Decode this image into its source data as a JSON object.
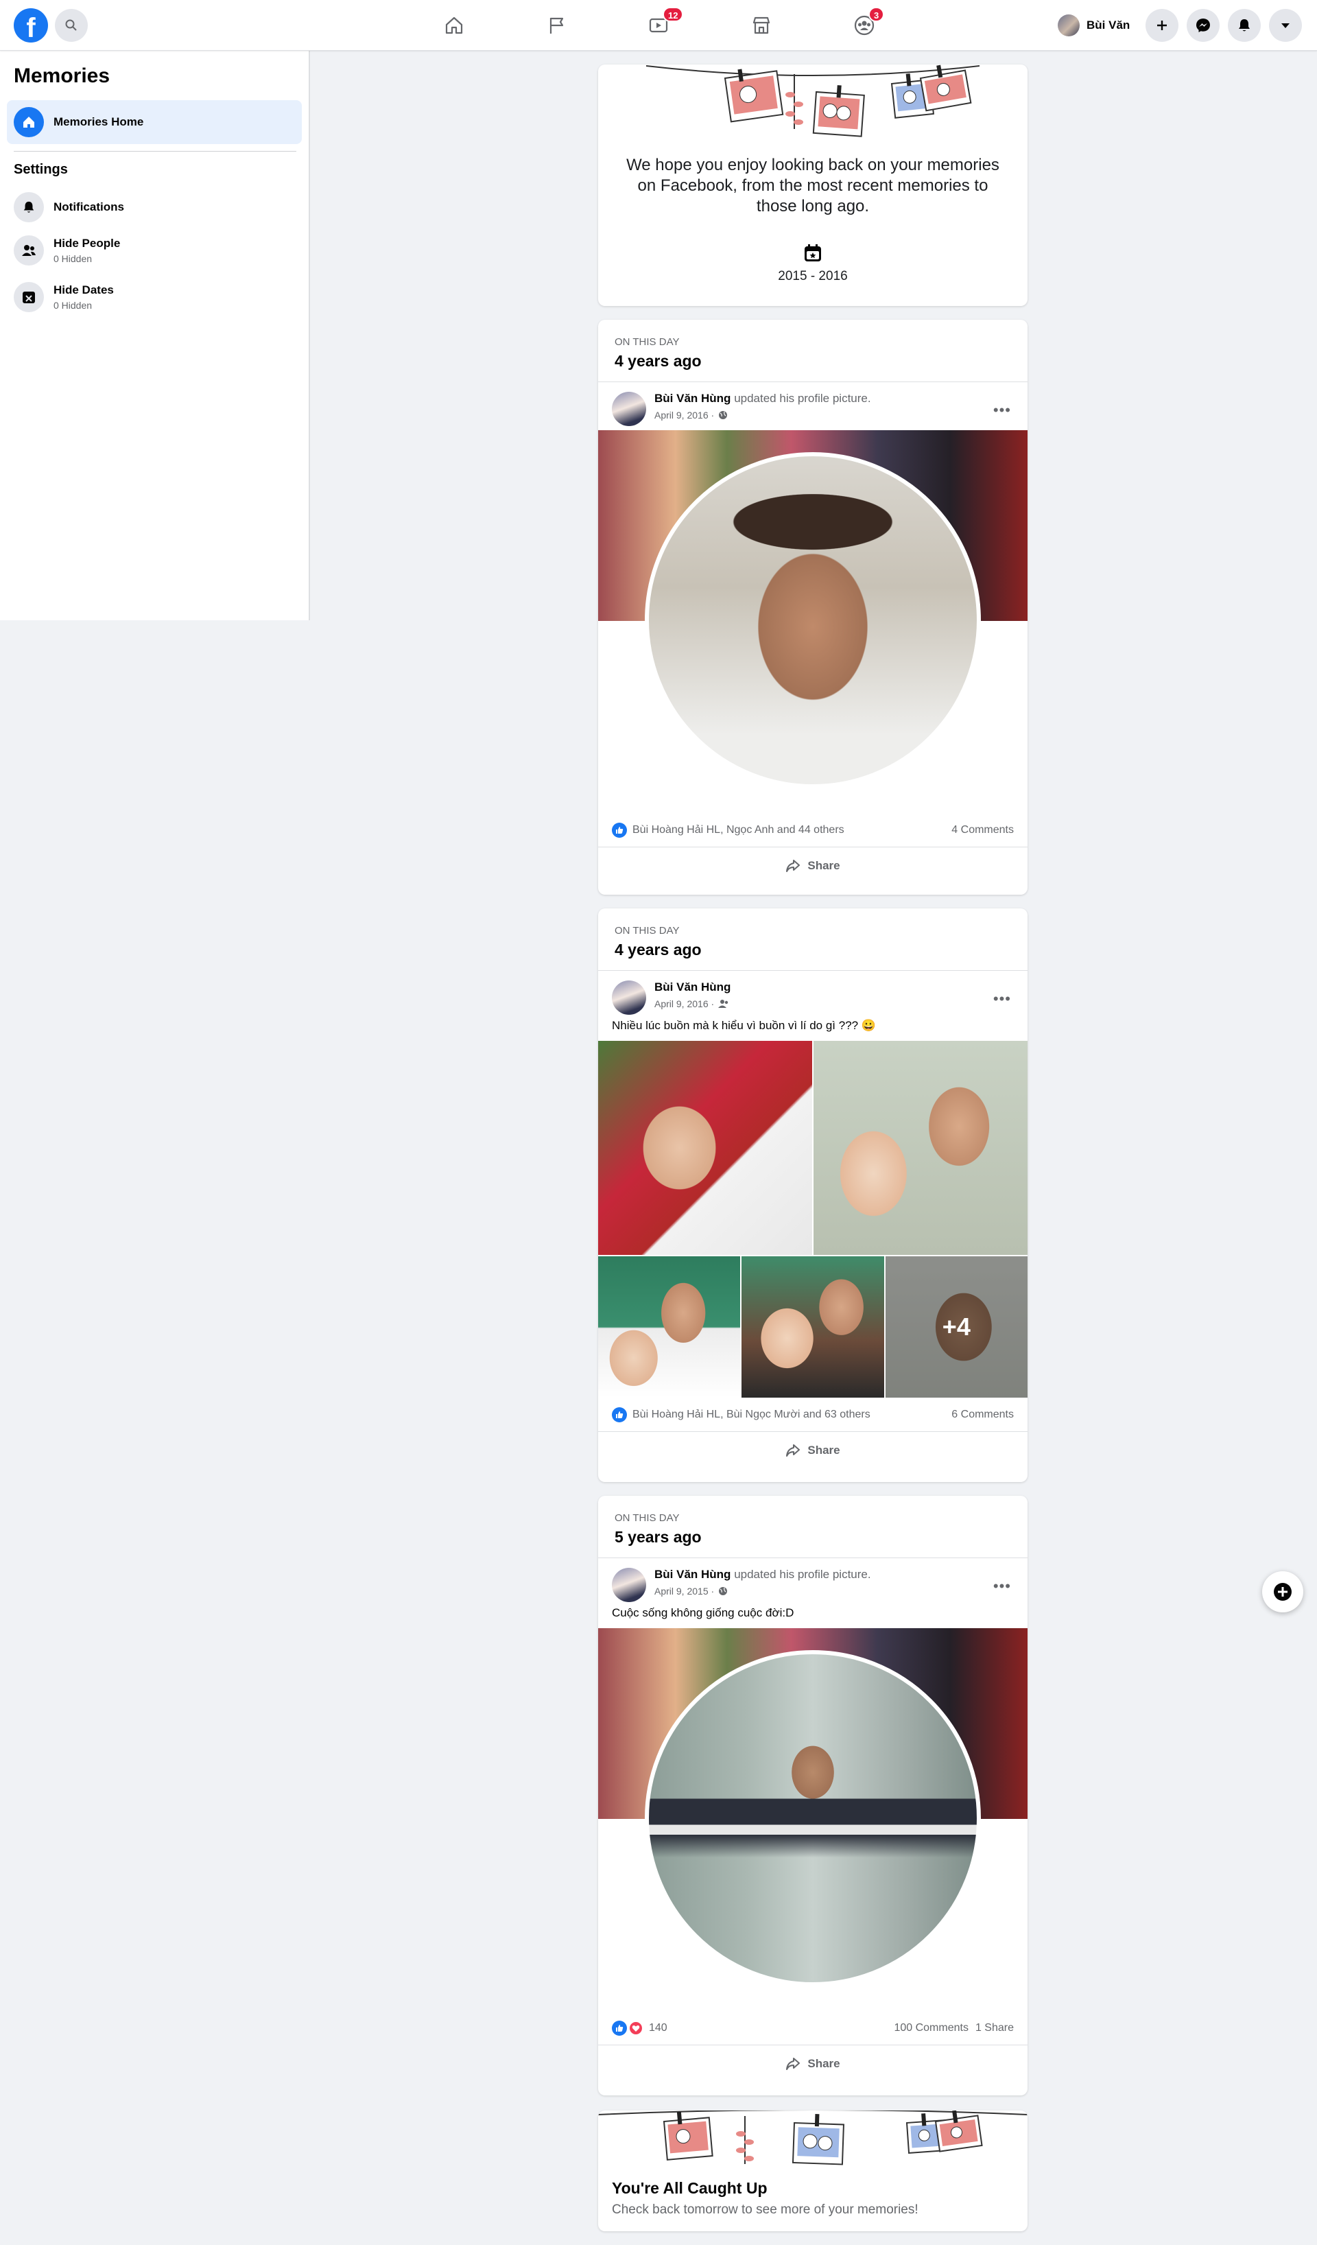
{
  "header": {
    "logo": "f",
    "nav_badges": {
      "watch": "12",
      "groups": "3"
    },
    "profile_name": "Bùi Văn"
  },
  "sidebar": {
    "title": "Memories",
    "home_label": "Memories Home",
    "settings_label": "Settings",
    "items": [
      {
        "label": "Notifications",
        "sub": ""
      },
      {
        "label": "Hide People",
        "sub": "0 Hidden"
      },
      {
        "label": "Hide Dates",
        "sub": "0 Hidden"
      }
    ]
  },
  "intro": {
    "message": "We hope you enjoy looking back on your memories on Facebook, from the most recent memories to those long ago.",
    "years": "2015 - 2016"
  },
  "memories": [
    {
      "on_this_day": "ON THIS DAY",
      "ago": "4 years ago",
      "author": "Bùi Văn Hùng",
      "action": "updated his profile picture.",
      "date": "April 9, 2016 ·",
      "privacy_icon": "globe-icon",
      "text": "",
      "reactions": "Bùi Hoàng Hải HL, Ngọc Anh and 44 others",
      "comments": "4 Comments",
      "share": "Share"
    },
    {
      "on_this_day": "ON THIS DAY",
      "ago": "4 years ago",
      "author": "Bùi Văn Hùng",
      "action": "",
      "date": "April 9, 2016 ·",
      "privacy_icon": "friends-icon",
      "text": "Nhiều lúc buồn mà k hiểu vì buồn vì lí do gì ??? 😀",
      "more_photos": "+4",
      "reactions": "Bùi Hoàng Hải HL, Bùi Ngọc Mười and 63 others",
      "comments": "6 Comments",
      "share": "Share"
    },
    {
      "on_this_day": "ON THIS DAY",
      "ago": "5 years ago",
      "author": "Bùi Văn Hùng",
      "action": "updated his profile picture.",
      "date": "April 9, 2015 ·",
      "privacy_icon": "globe-icon",
      "text": "Cuộc sống không giống cuộc đời:D",
      "reactions": "140",
      "comments": "100 Comments",
      "shares": "1 Share",
      "share": "Share"
    }
  ],
  "end": {
    "title": "You're All Caught Up",
    "subtitle": "Check back tomorrow to see more of your memories!"
  },
  "colors": {
    "brand": "#1877f2",
    "badge": "#e41e3f",
    "love": "#f33e58"
  }
}
